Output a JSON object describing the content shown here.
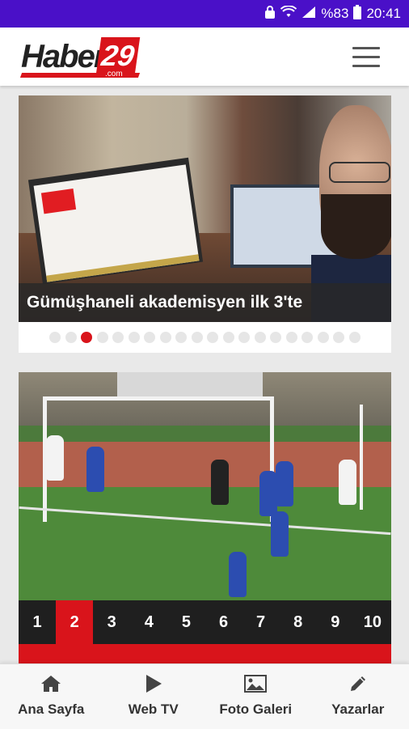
{
  "status_bar": {
    "battery_percent": "%83",
    "time": "20:41",
    "icons": [
      "lock-icon",
      "wifi-icon",
      "signal-icon",
      "battery-icon"
    ]
  },
  "app_bar": {
    "logo_text": "Haber",
    "logo_number": "29",
    "logo_suffix": ".com",
    "menu_icon": "hamburger-menu-icon"
  },
  "slider": {
    "caption": "Gümüşhaneli akademisyen ilk 3'te",
    "dots_total": 20,
    "active_dot": 3
  },
  "gallery": {
    "pages": [
      "1",
      "2",
      "3",
      "4",
      "5",
      "6",
      "7",
      "8",
      "9",
      "10"
    ],
    "active_page": "2"
  },
  "bottom_nav": [
    {
      "label": "Ana Sayfa",
      "icon": "home-icon"
    },
    {
      "label": "Web TV",
      "icon": "play-icon"
    },
    {
      "label": "Foto Galeri",
      "icon": "image-icon"
    },
    {
      "label": "Yazarlar",
      "icon": "pencil-icon"
    }
  ],
  "colors": {
    "status_bar": "#4a10c8",
    "accent": "#d9141b",
    "pager_bg": "#1f1f1f"
  }
}
